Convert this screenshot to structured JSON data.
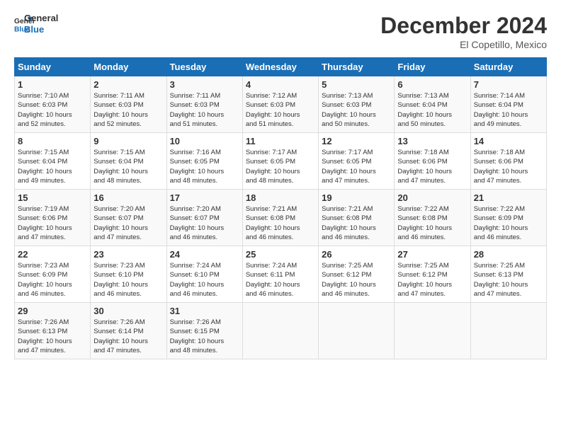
{
  "logo": {
    "line1": "General",
    "line2": "Blue"
  },
  "title": "December 2024",
  "location": "El Copetillo, Mexico",
  "days_of_week": [
    "Sunday",
    "Monday",
    "Tuesday",
    "Wednesday",
    "Thursday",
    "Friday",
    "Saturday"
  ],
  "weeks": [
    [
      {
        "day": "1",
        "sunrise": "Sunrise: 7:10 AM",
        "sunset": "Sunset: 6:03 PM",
        "daylight": "Daylight: 10 hours and 52 minutes."
      },
      {
        "day": "2",
        "sunrise": "Sunrise: 7:11 AM",
        "sunset": "Sunset: 6:03 PM",
        "daylight": "Daylight: 10 hours and 52 minutes."
      },
      {
        "day": "3",
        "sunrise": "Sunrise: 7:11 AM",
        "sunset": "Sunset: 6:03 PM",
        "daylight": "Daylight: 10 hours and 51 minutes."
      },
      {
        "day": "4",
        "sunrise": "Sunrise: 7:12 AM",
        "sunset": "Sunset: 6:03 PM",
        "daylight": "Daylight: 10 hours and 51 minutes."
      },
      {
        "day": "5",
        "sunrise": "Sunrise: 7:13 AM",
        "sunset": "Sunset: 6:03 PM",
        "daylight": "Daylight: 10 hours and 50 minutes."
      },
      {
        "day": "6",
        "sunrise": "Sunrise: 7:13 AM",
        "sunset": "Sunset: 6:04 PM",
        "daylight": "Daylight: 10 hours and 50 minutes."
      },
      {
        "day": "7",
        "sunrise": "Sunrise: 7:14 AM",
        "sunset": "Sunset: 6:04 PM",
        "daylight": "Daylight: 10 hours and 49 minutes."
      }
    ],
    [
      {
        "day": "8",
        "sunrise": "Sunrise: 7:15 AM",
        "sunset": "Sunset: 6:04 PM",
        "daylight": "Daylight: 10 hours and 49 minutes."
      },
      {
        "day": "9",
        "sunrise": "Sunrise: 7:15 AM",
        "sunset": "Sunset: 6:04 PM",
        "daylight": "Daylight: 10 hours and 48 minutes."
      },
      {
        "day": "10",
        "sunrise": "Sunrise: 7:16 AM",
        "sunset": "Sunset: 6:05 PM",
        "daylight": "Daylight: 10 hours and 48 minutes."
      },
      {
        "day": "11",
        "sunrise": "Sunrise: 7:17 AM",
        "sunset": "Sunset: 6:05 PM",
        "daylight": "Daylight: 10 hours and 48 minutes."
      },
      {
        "day": "12",
        "sunrise": "Sunrise: 7:17 AM",
        "sunset": "Sunset: 6:05 PM",
        "daylight": "Daylight: 10 hours and 47 minutes."
      },
      {
        "day": "13",
        "sunrise": "Sunrise: 7:18 AM",
        "sunset": "Sunset: 6:06 PM",
        "daylight": "Daylight: 10 hours and 47 minutes."
      },
      {
        "day": "14",
        "sunrise": "Sunrise: 7:18 AM",
        "sunset": "Sunset: 6:06 PM",
        "daylight": "Daylight: 10 hours and 47 minutes."
      }
    ],
    [
      {
        "day": "15",
        "sunrise": "Sunrise: 7:19 AM",
        "sunset": "Sunset: 6:06 PM",
        "daylight": "Daylight: 10 hours and 47 minutes."
      },
      {
        "day": "16",
        "sunrise": "Sunrise: 7:20 AM",
        "sunset": "Sunset: 6:07 PM",
        "daylight": "Daylight: 10 hours and 47 minutes."
      },
      {
        "day": "17",
        "sunrise": "Sunrise: 7:20 AM",
        "sunset": "Sunset: 6:07 PM",
        "daylight": "Daylight: 10 hours and 46 minutes."
      },
      {
        "day": "18",
        "sunrise": "Sunrise: 7:21 AM",
        "sunset": "Sunset: 6:08 PM",
        "daylight": "Daylight: 10 hours and 46 minutes."
      },
      {
        "day": "19",
        "sunrise": "Sunrise: 7:21 AM",
        "sunset": "Sunset: 6:08 PM",
        "daylight": "Daylight: 10 hours and 46 minutes."
      },
      {
        "day": "20",
        "sunrise": "Sunrise: 7:22 AM",
        "sunset": "Sunset: 6:08 PM",
        "daylight": "Daylight: 10 hours and 46 minutes."
      },
      {
        "day": "21",
        "sunrise": "Sunrise: 7:22 AM",
        "sunset": "Sunset: 6:09 PM",
        "daylight": "Daylight: 10 hours and 46 minutes."
      }
    ],
    [
      {
        "day": "22",
        "sunrise": "Sunrise: 7:23 AM",
        "sunset": "Sunset: 6:09 PM",
        "daylight": "Daylight: 10 hours and 46 minutes."
      },
      {
        "day": "23",
        "sunrise": "Sunrise: 7:23 AM",
        "sunset": "Sunset: 6:10 PM",
        "daylight": "Daylight: 10 hours and 46 minutes."
      },
      {
        "day": "24",
        "sunrise": "Sunrise: 7:24 AM",
        "sunset": "Sunset: 6:10 PM",
        "daylight": "Daylight: 10 hours and 46 minutes."
      },
      {
        "day": "25",
        "sunrise": "Sunrise: 7:24 AM",
        "sunset": "Sunset: 6:11 PM",
        "daylight": "Daylight: 10 hours and 46 minutes."
      },
      {
        "day": "26",
        "sunrise": "Sunrise: 7:25 AM",
        "sunset": "Sunset: 6:12 PM",
        "daylight": "Daylight: 10 hours and 46 minutes."
      },
      {
        "day": "27",
        "sunrise": "Sunrise: 7:25 AM",
        "sunset": "Sunset: 6:12 PM",
        "daylight": "Daylight: 10 hours and 47 minutes."
      },
      {
        "day": "28",
        "sunrise": "Sunrise: 7:25 AM",
        "sunset": "Sunset: 6:13 PM",
        "daylight": "Daylight: 10 hours and 47 minutes."
      }
    ],
    [
      {
        "day": "29",
        "sunrise": "Sunrise: 7:26 AM",
        "sunset": "Sunset: 6:13 PM",
        "daylight": "Daylight: 10 hours and 47 minutes."
      },
      {
        "day": "30",
        "sunrise": "Sunrise: 7:26 AM",
        "sunset": "Sunset: 6:14 PM",
        "daylight": "Daylight: 10 hours and 47 minutes."
      },
      {
        "day": "31",
        "sunrise": "Sunrise: 7:26 AM",
        "sunset": "Sunset: 6:15 PM",
        "daylight": "Daylight: 10 hours and 48 minutes."
      },
      {
        "day": "",
        "sunrise": "",
        "sunset": "",
        "daylight": ""
      },
      {
        "day": "",
        "sunrise": "",
        "sunset": "",
        "daylight": ""
      },
      {
        "day": "",
        "sunrise": "",
        "sunset": "",
        "daylight": ""
      },
      {
        "day": "",
        "sunrise": "",
        "sunset": "",
        "daylight": ""
      }
    ]
  ]
}
